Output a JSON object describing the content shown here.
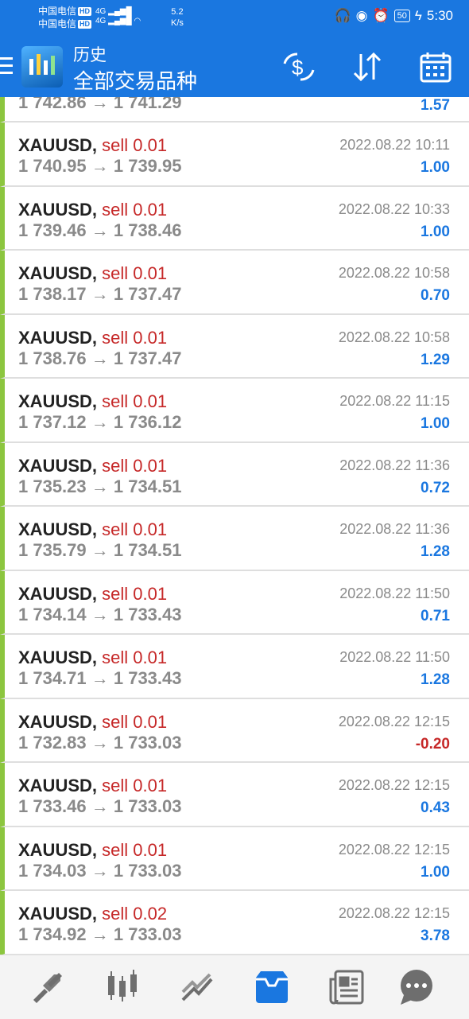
{
  "status_bar": {
    "carrier1": "中国电信",
    "carrier2": "中国电信",
    "hd": "HD",
    "net1": "4G",
    "net2": "4G",
    "speed": "5.2",
    "speed_unit": "K/s",
    "battery": "50",
    "time": "5:30"
  },
  "header": {
    "title": "历史",
    "subtitle": "全部交易品种"
  },
  "first_row": {
    "prices": "1 742.86 → 1 741.29",
    "profit": "1.57"
  },
  "trades": [
    {
      "symbol": "XAUUSD,",
      "type": "sell 0.01",
      "date": "2022.08.22 10:11",
      "prices": "1 740.95 → 1 739.95",
      "profit": "1.00"
    },
    {
      "symbol": "XAUUSD,",
      "type": "sell 0.01",
      "date": "2022.08.22 10:33",
      "prices": "1 739.46 → 1 738.46",
      "profit": "1.00"
    },
    {
      "symbol": "XAUUSD,",
      "type": "sell 0.01",
      "date": "2022.08.22 10:58",
      "prices": "1 738.17 → 1 737.47",
      "profit": "0.70"
    },
    {
      "symbol": "XAUUSD,",
      "type": "sell 0.01",
      "date": "2022.08.22 10:58",
      "prices": "1 738.76 → 1 737.47",
      "profit": "1.29"
    },
    {
      "symbol": "XAUUSD,",
      "type": "sell 0.01",
      "date": "2022.08.22 11:15",
      "prices": "1 737.12 → 1 736.12",
      "profit": "1.00"
    },
    {
      "symbol": "XAUUSD,",
      "type": "sell 0.01",
      "date": "2022.08.22 11:36",
      "prices": "1 735.23 → 1 734.51",
      "profit": "0.72"
    },
    {
      "symbol": "XAUUSD,",
      "type": "sell 0.01",
      "date": "2022.08.22 11:36",
      "prices": "1 735.79 → 1 734.51",
      "profit": "1.28"
    },
    {
      "symbol": "XAUUSD,",
      "type": "sell 0.01",
      "date": "2022.08.22 11:50",
      "prices": "1 734.14 → 1 733.43",
      "profit": "0.71"
    },
    {
      "symbol": "XAUUSD,",
      "type": "sell 0.01",
      "date": "2022.08.22 11:50",
      "prices": "1 734.71 → 1 733.43",
      "profit": "1.28"
    },
    {
      "symbol": "XAUUSD,",
      "type": "sell 0.01",
      "date": "2022.08.22 12:15",
      "prices": "1 732.83 → 1 733.03",
      "profit": "-0.20"
    },
    {
      "symbol": "XAUUSD,",
      "type": "sell 0.01",
      "date": "2022.08.22 12:15",
      "prices": "1 733.46 → 1 733.03",
      "profit": "0.43"
    },
    {
      "symbol": "XAUUSD,",
      "type": "sell 0.01",
      "date": "2022.08.22 12:15",
      "prices": "1 734.03 → 1 733.03",
      "profit": "1.00"
    },
    {
      "symbol": "XAUUSD,",
      "type": "sell 0.02",
      "date": "2022.08.22 12:15",
      "prices": "1 734.92 → 1 733.03",
      "profit": "3.78"
    }
  ],
  "nav": [
    "trade-icon",
    "chart-icon",
    "history-icon",
    "inbox-icon",
    "news-icon",
    "chat-icon"
  ],
  "colors": {
    "accent": "#1a77e0",
    "sell": "#c62828",
    "profit": "#1a77e0",
    "row_marker": "#8cc63f"
  }
}
